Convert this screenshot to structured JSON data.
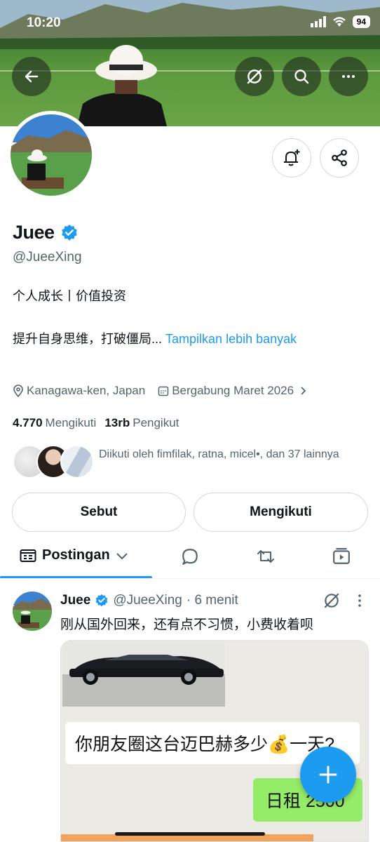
{
  "status_bar": {
    "time": "10:20",
    "battery": "94"
  },
  "profile": {
    "name": "Juee",
    "handle": "@JueeXing",
    "bio_line1": "个人成长丨价值投资",
    "bio_line2": "提升自身思维，打破僵局...",
    "show_more": "Tampilkan lebih banyak",
    "location": "Kanagawa-ken, Japan",
    "joined": "Bergabung Maret 2026",
    "following_count": "4.770",
    "following_label": "Mengikuti",
    "followers_count": "13rb",
    "followers_label": "Pengikut",
    "followed_by": "Diikuti oleh fimfilak, ratna, micel•, dan 37 lainnya"
  },
  "buttons": {
    "mention": "Sebut",
    "following": "Mengikuti"
  },
  "tabs": {
    "posts": "Postingan"
  },
  "post": {
    "name": "Juee",
    "handle": "@JueeXing",
    "time": "· 6 menit",
    "text": "刚从国外回来，还有点不习惯，小费收着呗",
    "media_chat_question": "你朋友圈这台迈巴赫多少💰一天?",
    "media_chat_reply": "日租 2500"
  },
  "colors": {
    "accent": "#1d9bf0",
    "verified": "#1d9bf0",
    "wechat_green": "#95ec69"
  },
  "icons": [
    "back-arrow-icon",
    "grok-icon",
    "search-icon",
    "more-icon",
    "bell-plus-icon",
    "share-icon",
    "verified-icon",
    "location-icon",
    "calendar-icon",
    "chevron-right-icon",
    "posts-icon",
    "chevron-down-icon",
    "reply-icon",
    "repost-icon",
    "video-icon",
    "plus-icon"
  ]
}
